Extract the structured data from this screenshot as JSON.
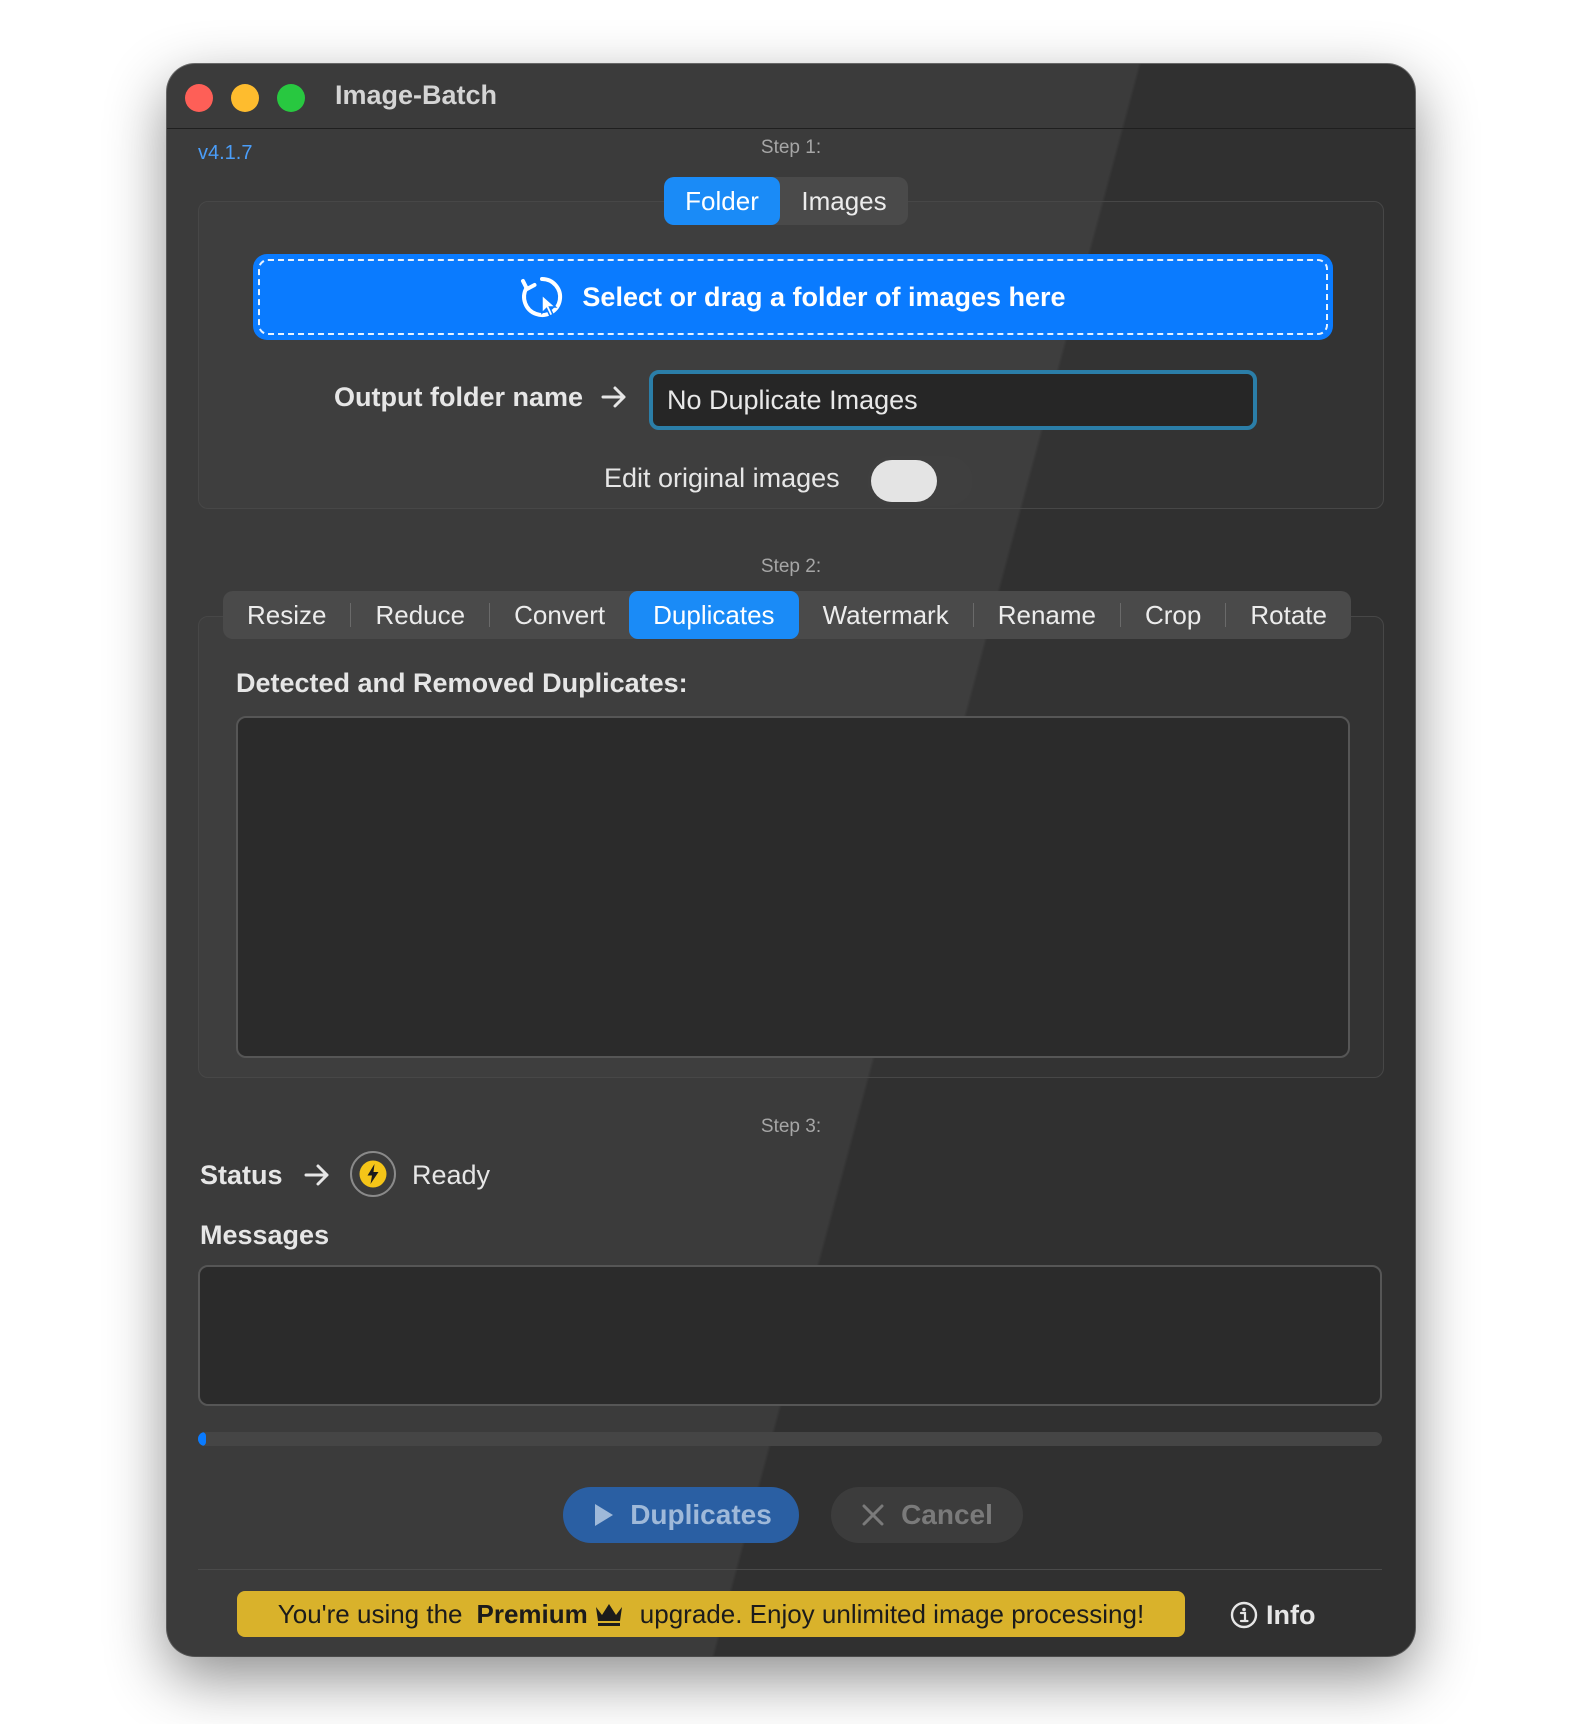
{
  "window": {
    "title": "Image-Batch",
    "version": "v4.1.7"
  },
  "step1": {
    "label": "Step 1:",
    "source_tabs": [
      {
        "label": "Folder",
        "active": true
      },
      {
        "label": "Images",
        "active": false
      }
    ],
    "dropzone_label": "Select or drag a folder of images here",
    "output_label": "Output folder name",
    "output_value": "No Duplicate Images",
    "edit_original_label": "Edit original images",
    "edit_original_on": false
  },
  "step2": {
    "label": "Step 2:",
    "tabs": [
      {
        "label": "Resize",
        "active": false
      },
      {
        "label": "Reduce",
        "active": false
      },
      {
        "label": "Convert",
        "active": false
      },
      {
        "label": "Duplicates",
        "active": true
      },
      {
        "label": "Watermark",
        "active": false
      },
      {
        "label": "Rename",
        "active": false
      },
      {
        "label": "Crop",
        "active": false
      },
      {
        "label": "Rotate",
        "active": false
      }
    ],
    "duplicates_heading": "Detected and Removed Duplicates:",
    "duplicates_items": []
  },
  "step3": {
    "label": "Step 3:",
    "status_label": "Status",
    "status_value": "Ready",
    "messages_label": "Messages",
    "messages": [],
    "progress": 0.005
  },
  "actions": {
    "run_label": "Duplicates",
    "cancel_label": "Cancel"
  },
  "footer": {
    "banner_prefix": "You're using the",
    "banner_bold": "Premium",
    "banner_suffix": "upgrade. Enjoy unlimited image processing!",
    "info_label": "Info"
  },
  "colors": {
    "accent": "#0a7bff",
    "window_bg": "#323232",
    "banner": "#d9b22b",
    "status_icon": "#f5c518"
  },
  "icons": {
    "dropzone": "pointer-refresh-icon",
    "status": "bolt-icon",
    "run": "play-icon",
    "cancel": "x-icon",
    "premium": "crown-icon",
    "info": "info-circle-icon"
  }
}
